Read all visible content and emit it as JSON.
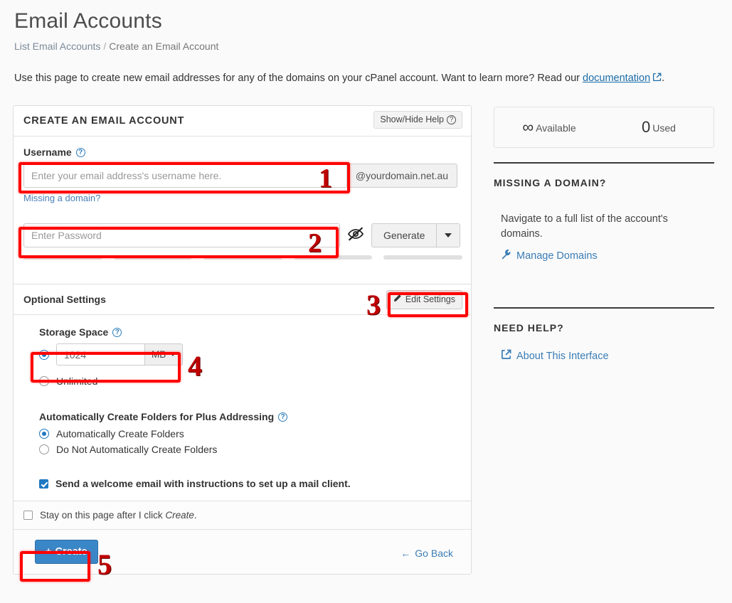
{
  "header": {
    "title": "Email Accounts",
    "breadcrumb_link": "List Email Accounts",
    "breadcrumb_sep": "/",
    "breadcrumb_current": "Create an Email Account",
    "intro_before": "Use this page to create new email addresses for any of the domains on your cPanel account. Want to learn more? Read our ",
    "intro_link": "documentation",
    "intro_after": "."
  },
  "panel": {
    "title": "CREATE AN EMAIL ACCOUNT",
    "help_button": "Show/Hide Help",
    "username_label": "Username",
    "username_placeholder": "Enter your email address's username here.",
    "domain_suffix": "@yourdomain.net.au",
    "missing_domain_link": "Missing a domain?",
    "password_placeholder": "Enter Password",
    "generate_button": "Generate",
    "strength_segments": 5,
    "optional_settings_title": "Optional Settings",
    "edit_settings_button": "Edit Settings",
    "storage_label": "Storage Space",
    "storage_value": "1024",
    "storage_unit": "MB",
    "storage_unlimited_label": "Unlimited",
    "plus_addressing_label": "Automatically Create Folders for Plus Addressing",
    "plus_option_yes": "Automatically Create Folders",
    "plus_option_no": "Do Not Automatically Create Folders",
    "welcome_email_label": "Send a welcome email with instructions to set up a mail client.",
    "stay_on_page_before": "Stay on this page after I click ",
    "stay_on_page_em": "Create",
    "stay_on_page_after": ".",
    "create_button": "Create",
    "go_back_link": "Go Back"
  },
  "sidebar": {
    "available_value": "∞",
    "available_label": "Available",
    "used_value": "0",
    "used_label": "Used",
    "missing_domain_heading": "MISSING A DOMAIN?",
    "missing_domain_text": "Navigate to a full list of the account's domains.",
    "manage_domains_link": "Manage Domains",
    "need_help_heading": "NEED HELP?",
    "about_interface_link": "About This Interface"
  },
  "annotations": {
    "one": "1",
    "two": "2",
    "three": "3",
    "four": "4",
    "five": "5"
  },
  "colors": {
    "accent": "#3a87c8",
    "link": "#3a7cb5",
    "annotation": "#ff0000"
  }
}
